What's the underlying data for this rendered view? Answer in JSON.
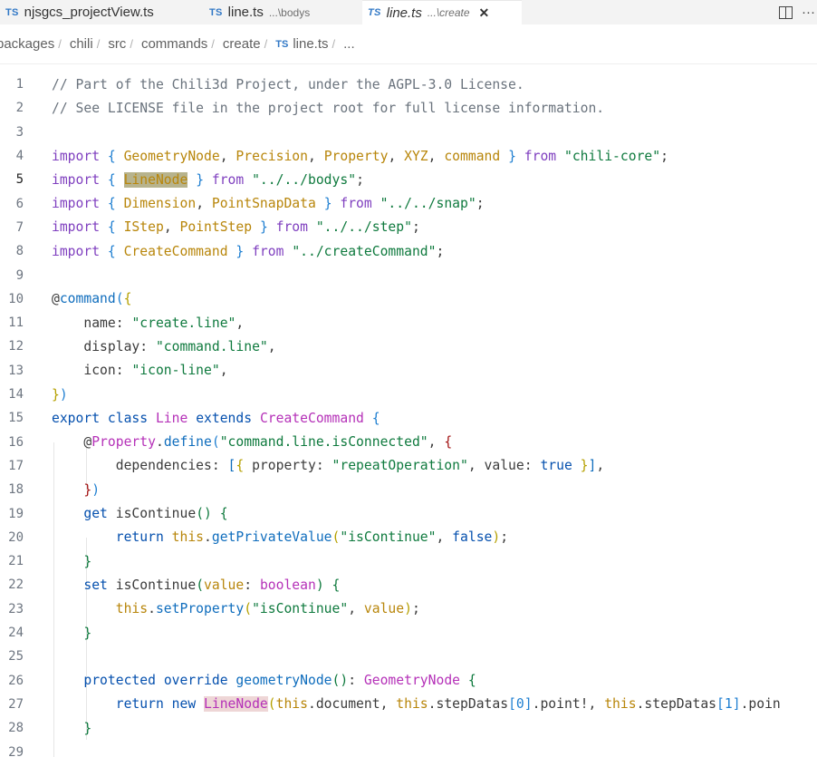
{
  "tabs": [
    {
      "label": "njsgcs_projectView.ts",
      "badge": "TS",
      "desc": ""
    },
    {
      "label": "line.ts",
      "badge": "TS",
      "desc": "...\\bodys"
    },
    {
      "label": "line.ts",
      "badge": "TS",
      "desc": "...\\create",
      "close": "✕"
    }
  ],
  "breadcrumb": {
    "items": [
      "packages",
      "chili",
      "src",
      "commands",
      "create"
    ],
    "file_badge": "TS",
    "file": "line.ts",
    "tail": "..."
  },
  "actions": {
    "more": "···"
  },
  "line_numbers": [
    "1",
    "2",
    "3",
    "4",
    "5",
    "6",
    "7",
    "8",
    "9",
    "10",
    "11",
    "12",
    "13",
    "14",
    "15",
    "16",
    "17",
    "18",
    "19",
    "20",
    "21",
    "22",
    "23",
    "24",
    "25",
    "26",
    "27",
    "28",
    "29"
  ],
  "code": {
    "l1": "// Part of the Chili3d Project, under the AGPL-3.0 License.",
    "l2": "// See LICENSE file in the project root for full license information.",
    "l4": {
      "import": "import",
      "ob": "{",
      "a": "GeometryNode",
      "c1": ",",
      "b": "Precision",
      "c2": ",",
      "c": "Property",
      "c3": ",",
      "d": "XYZ",
      "c4": ",",
      "e": "command",
      "cb": "}",
      "from": "from",
      "src": "\"chili-core\"",
      "semi": ";"
    },
    "l5": {
      "import": "import",
      "ob": "{",
      "a": "LineNode",
      "cb": "}",
      "from": "from",
      "src": "\"../../bodys\"",
      "semi": ";"
    },
    "l6": {
      "import": "import",
      "ob": "{",
      "a": "Dimension",
      "c1": ",",
      "b": "PointSnapData",
      "cb": "}",
      "from": "from",
      "src": "\"../../snap\"",
      "semi": ";"
    },
    "l7": {
      "import": "import",
      "ob": "{",
      "a": "IStep",
      "c1": ",",
      "b": "PointStep",
      "cb": "}",
      "from": "from",
      "src": "\"../../step\"",
      "semi": ";"
    },
    "l8": {
      "import": "import",
      "ob": "{",
      "a": "CreateCommand",
      "cb": "}",
      "from": "from",
      "src": "\"../createCommand\"",
      "semi": ";"
    },
    "l10": {
      "at": "@",
      "fn": "command",
      "p": "(",
      "b": "{"
    },
    "l11": {
      "key": "name: ",
      "val": "\"create.line\"",
      "end": ","
    },
    "l12": {
      "key": "display: ",
      "val": "\"command.line\"",
      "end": ","
    },
    "l13": {
      "key": "icon: ",
      "val": "\"icon-line\"",
      "end": ","
    },
    "l14": {
      "b": "}",
      "p": ")"
    },
    "l15": {
      "export": "export",
      "class": "class",
      "name": "Line",
      "extends": "extends",
      "base": "CreateCommand",
      "b": "{"
    },
    "l16": {
      "at": "@",
      "cls": "Property",
      "dot": ".",
      "fn": "define",
      "p": "(",
      "str": "\"command.line.isConnected\"",
      "c": ",",
      "b": "{"
    },
    "l17": {
      "key": "dependencies: ",
      "lb": "[",
      "ob": "{",
      "k1": " property: ",
      "s1": "\"repeatOperation\"",
      "c": ",",
      "k2": " value: ",
      "v2": "true",
      "cb": " }",
      "rb": "]",
      "end": ","
    },
    "l18": {
      "b": "}",
      "p": ")"
    },
    "l19": {
      "get": "get",
      "fn": "isContinue",
      "p": "()",
      "b": "{"
    },
    "l20": {
      "ret": "return",
      "this": "this",
      "dot": ".",
      "fn": "getPrivateValue",
      "p1": "(",
      "s": "\"isContinue\"",
      "c": ",",
      "f": "false",
      "p2": ")",
      "semi": ";"
    },
    "l21": {
      "b": "}"
    },
    "l22": {
      "set": "set",
      "fn": "isContinue",
      "p1": "(",
      "arg": "value",
      "col": ": ",
      "type": "boolean",
      "p2": ")",
      "b": "{"
    },
    "l23": {
      "this": "this",
      "dot": ".",
      "fn": "setProperty",
      "p1": "(",
      "s": "\"isContinue\"",
      "c": ",",
      "arg": "value",
      "p2": ")",
      "semi": ";"
    },
    "l24": {
      "b": "}"
    },
    "l26": {
      "prot": "protected",
      "ovr": "override",
      "fn": "geometryNode",
      "p": "()",
      "col": ": ",
      "type": "GeometryNode",
      "b": "{"
    },
    "l27": {
      "ret": "return",
      "new": "new",
      "cls": "LineNode",
      "p1": "(",
      "this1": "this",
      "doc": ".document, ",
      "this2": "this",
      "sd1": ".stepDatas",
      "i0": "[0]",
      "pt1": ".point!, ",
      "this3": "this",
      "sd2": ".stepDatas",
      "i1": "[1]",
      "pt2": ".poin"
    },
    "l28": {
      "b": "}"
    }
  }
}
